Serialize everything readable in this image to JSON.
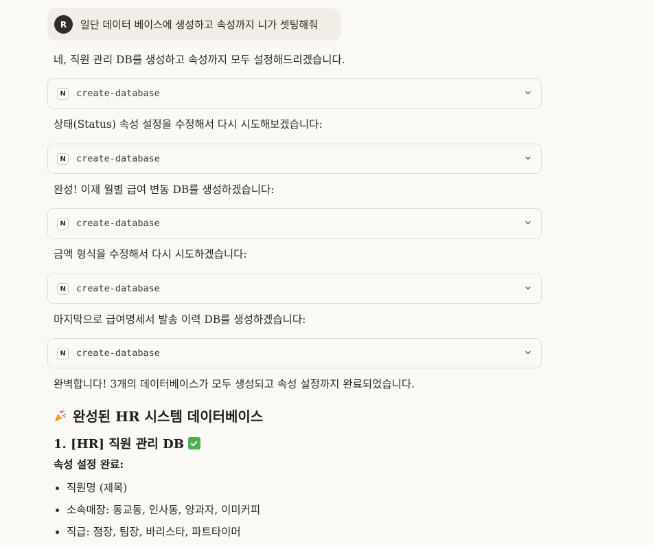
{
  "user_message": {
    "avatar_initial": "R",
    "text": "일단 데이터 베이스에 생성하고 속성까지 니가 셋팅해줘"
  },
  "assistant": {
    "intro": "네, 직원 관리 DB를 생성하고 속성까지 모두 설정해드리겠습니다.",
    "tool_calls": [
      {
        "badge": "N",
        "name": "create-database"
      },
      {
        "badge": "N",
        "name": "create-database"
      },
      {
        "badge": "N",
        "name": "create-database"
      },
      {
        "badge": "N",
        "name": "create-database"
      },
      {
        "badge": "N",
        "name": "create-database"
      }
    ],
    "messages": [
      "상태(Status) 속성 설정을 수정해서 다시 시도해보겠습니다:",
      "완성! 이제 월별 급여 변동 DB를 생성하겠습니다:",
      "금액 형식을 수정해서 다시 시도하겠습니다:",
      "마지막으로 급여명세서 발송 이력 DB를 생성하겠습니다:",
      "완벽합니다! 3개의 데이터베이스가 모두 생성되고 속성 설정까지 완료되었습니다."
    ],
    "summary_heading": "완성된 HR 시스템 데이터베이스",
    "section1": {
      "title": "1. [HR] 직원 관리 DB",
      "subheading": "속성 설정 완료:",
      "items": [
        "직원명 (제목)",
        "소속매장: 동교동, 인사동, 양과자, 이미커피",
        "직급: 점장, 팀장, 바리스타, 파트타이머"
      ]
    }
  },
  "icons": {
    "chevron": "chevron-down-icon",
    "party": "party-popper-icon",
    "check": "check-mark-icon"
  },
  "colors": {
    "background": "#faf9f5",
    "user_bubble": "#f0eee6",
    "card_border": "#dedcd4",
    "check_green": "#4caf50"
  }
}
